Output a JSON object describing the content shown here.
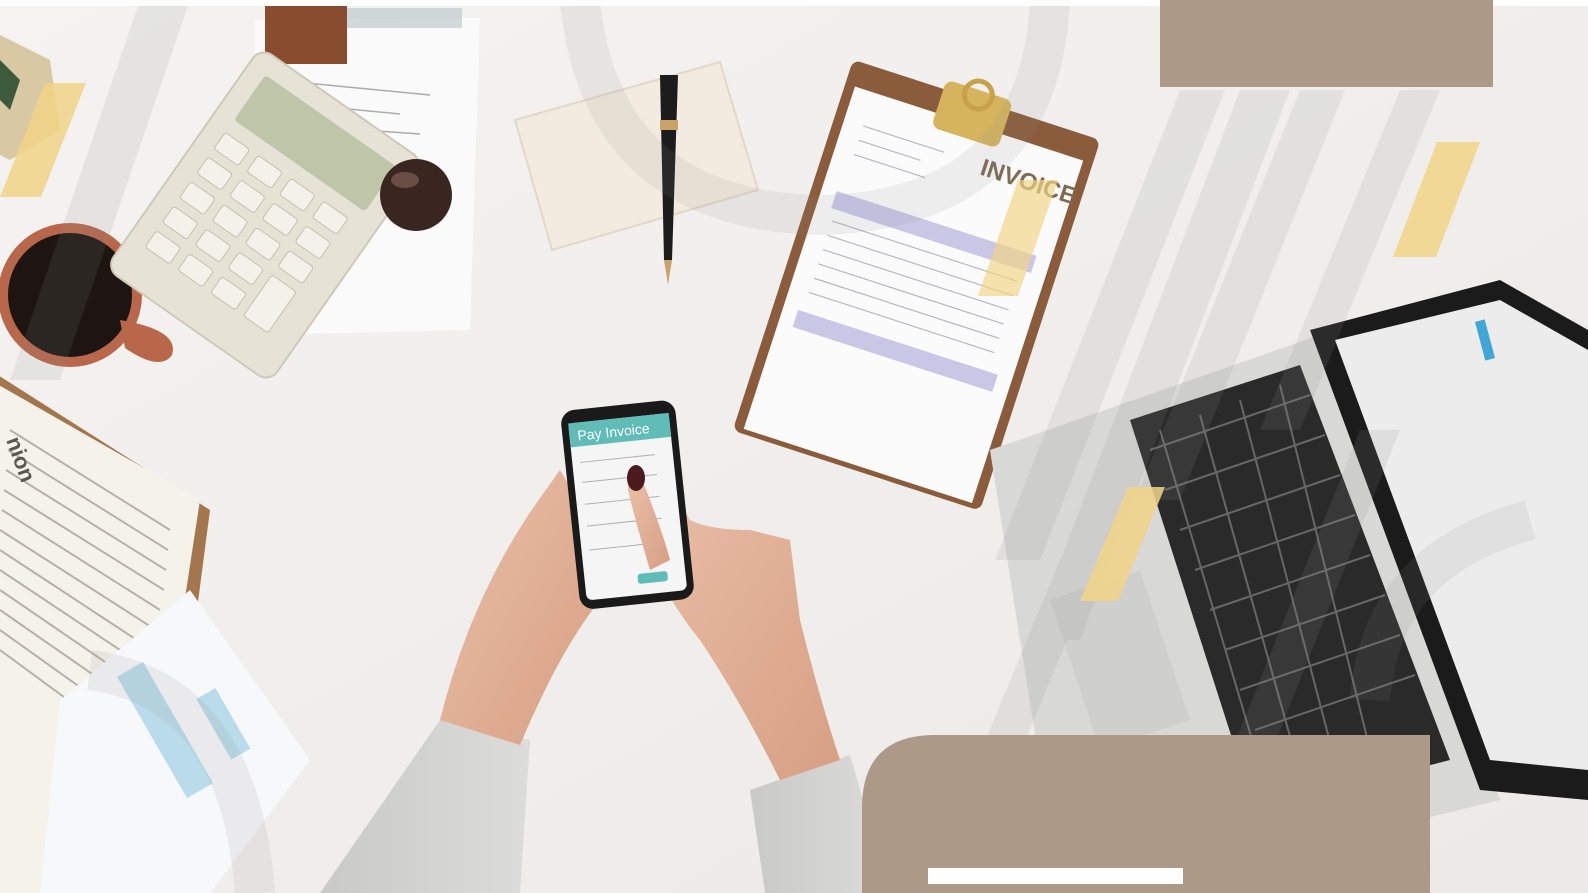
{
  "phone": {
    "screen_title": "Pay Invoice"
  },
  "clipboard": {
    "document_label": "INVOICE"
  },
  "colors": {
    "brand_tan": "#ac9988",
    "accent_yellow": "#f1d486",
    "desk": "#f0efed",
    "phone_teal": "#5fbcb6"
  }
}
